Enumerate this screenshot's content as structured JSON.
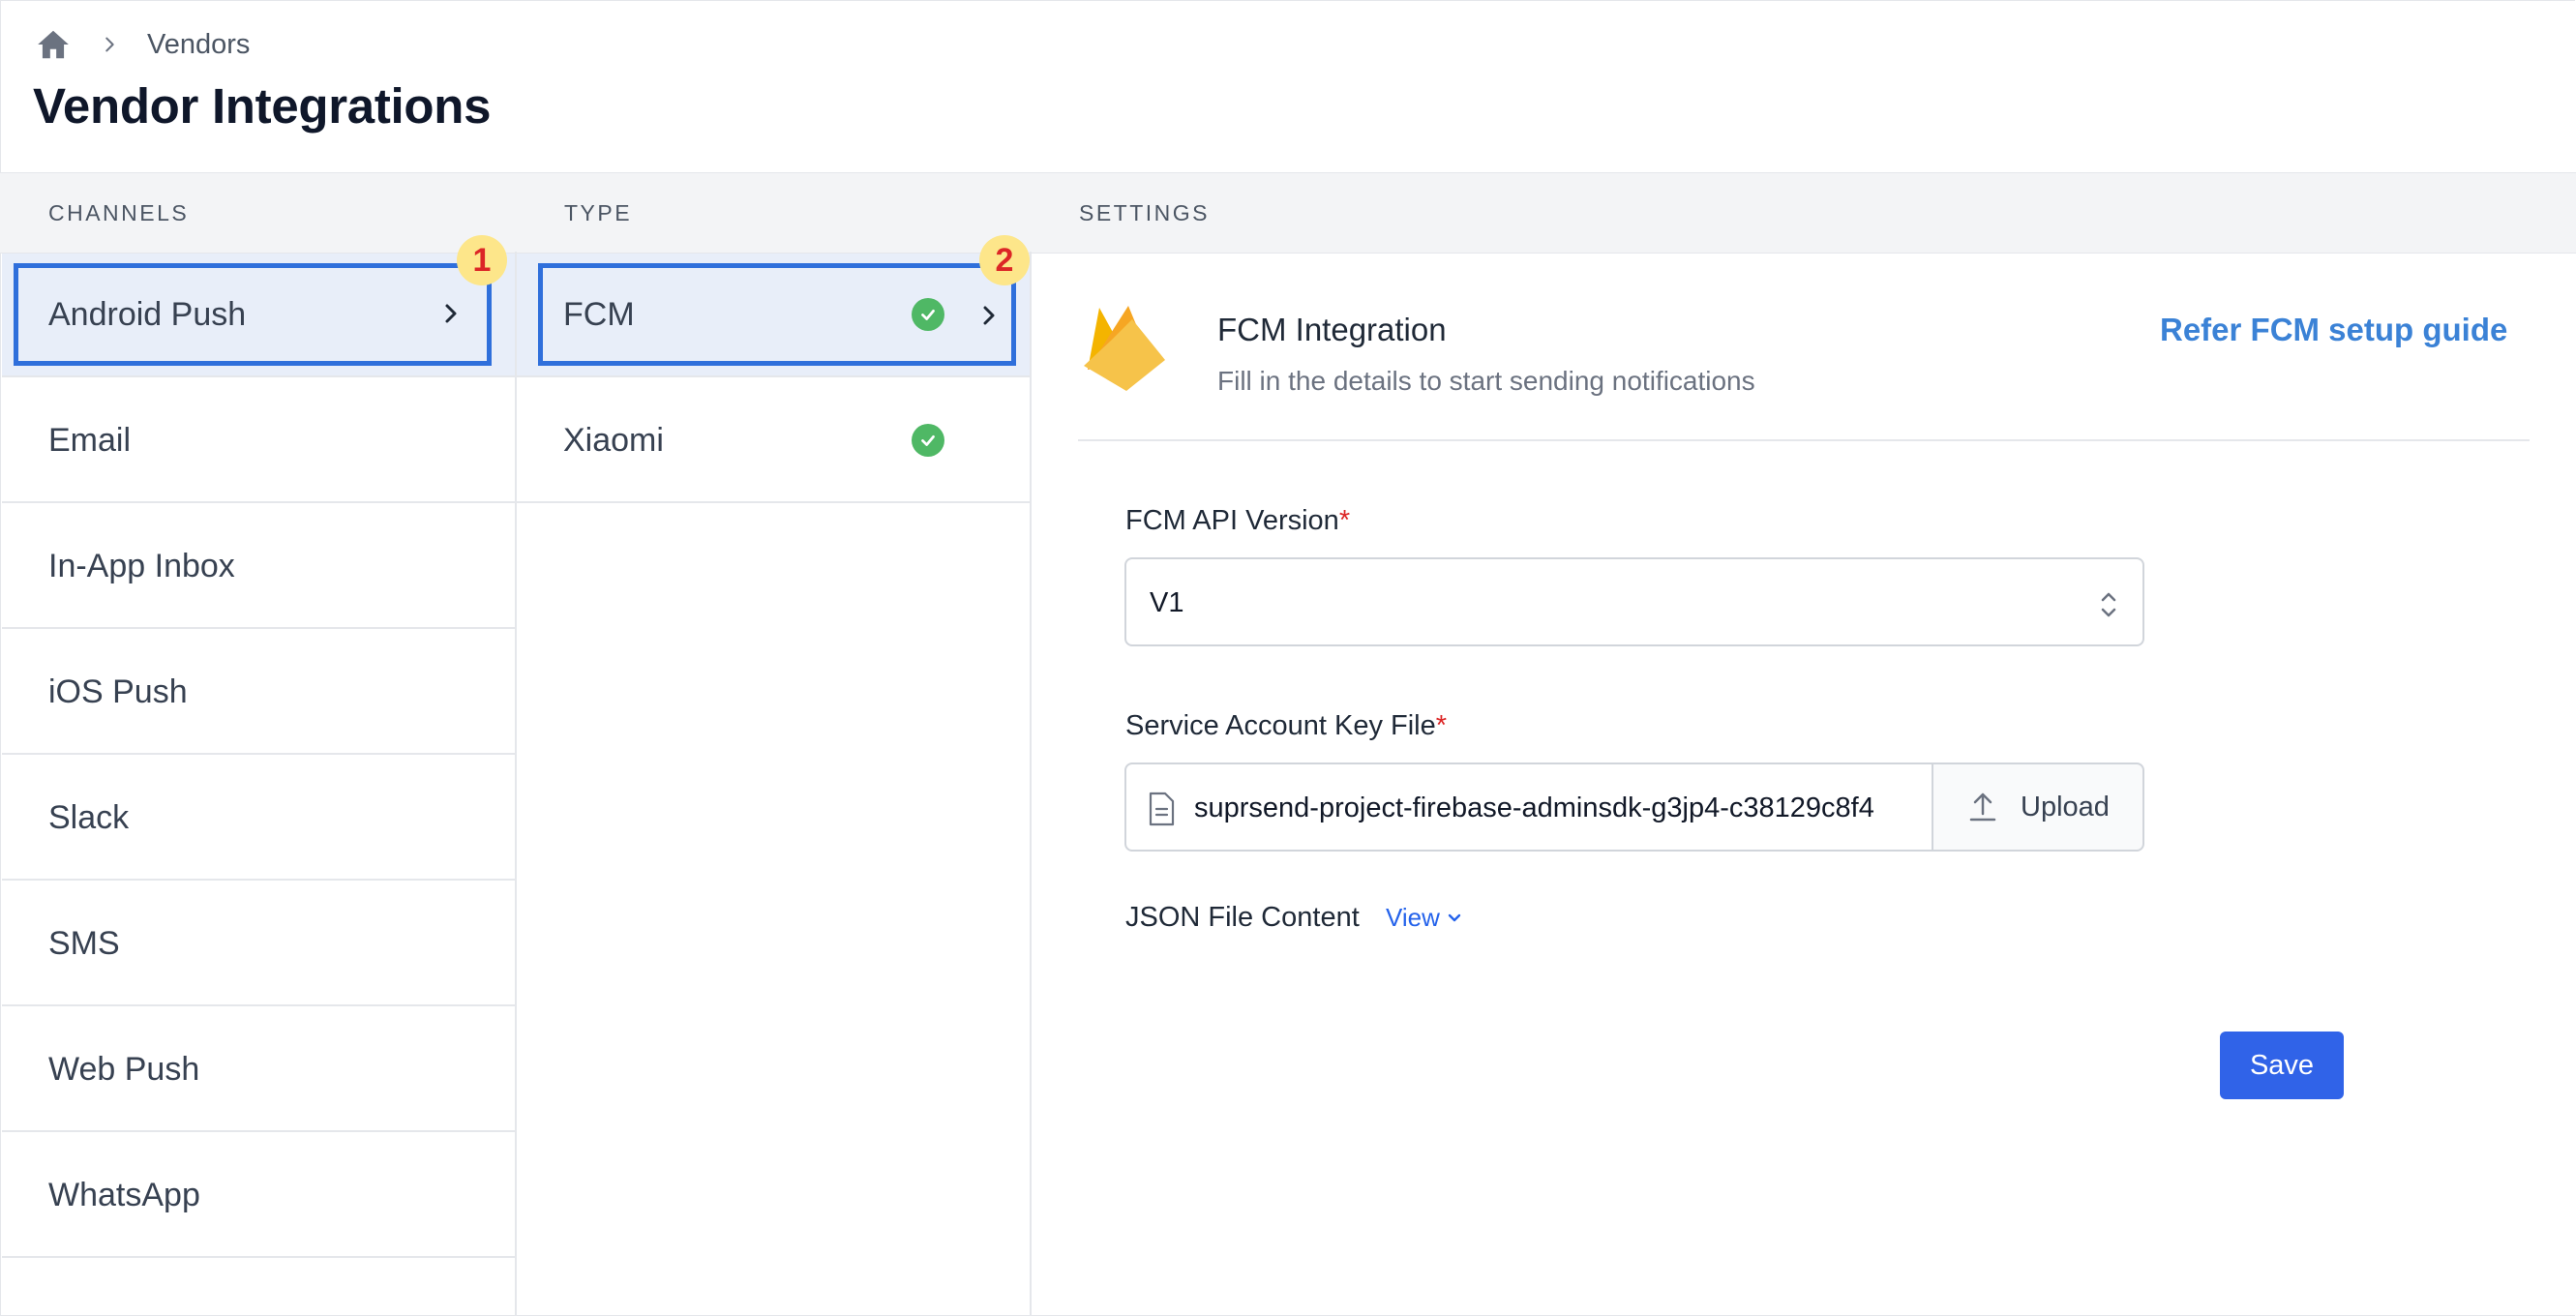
{
  "breadcrumb": {
    "items": [
      "Vendors"
    ]
  },
  "page": {
    "title": "Vendor Integrations"
  },
  "columns": {
    "channels": "CHANNELS",
    "type": "TYPE",
    "settings": "SETTINGS"
  },
  "channels": {
    "items": [
      {
        "label": "Android Push",
        "selected": true
      },
      {
        "label": "Email"
      },
      {
        "label": "In-App Inbox"
      },
      {
        "label": "iOS Push"
      },
      {
        "label": "Slack"
      },
      {
        "label": "SMS"
      },
      {
        "label": "Web Push"
      },
      {
        "label": "WhatsApp"
      }
    ]
  },
  "types": {
    "items": [
      {
        "label": "FCM",
        "status": "configured",
        "selected": true
      },
      {
        "label": "Xiaomi",
        "status": "configured"
      }
    ]
  },
  "annotations": {
    "badge1": "1",
    "badge2": "2"
  },
  "settings": {
    "integration_title": "FCM Integration",
    "integration_subtitle": "Fill in the details to start sending notifications",
    "guide_link": "Refer FCM setup guide",
    "api_version": {
      "label": "FCM API Version",
      "required_mark": "*",
      "value": "V1"
    },
    "key_file": {
      "label": "Service Account Key File",
      "required_mark": "*",
      "file_name": "suprsend-project-firebase-adminsdk-g3jp4-c38129c8f4",
      "upload_label": "Upload"
    },
    "json_content": {
      "label": "JSON File Content",
      "view_label": "View"
    },
    "save_label": "Save"
  },
  "colors": {
    "accent": "#3063e8",
    "selection_border": "#2f6fdb",
    "link": "#3b82d6",
    "success": "#4fb865",
    "required": "#dc2626"
  }
}
